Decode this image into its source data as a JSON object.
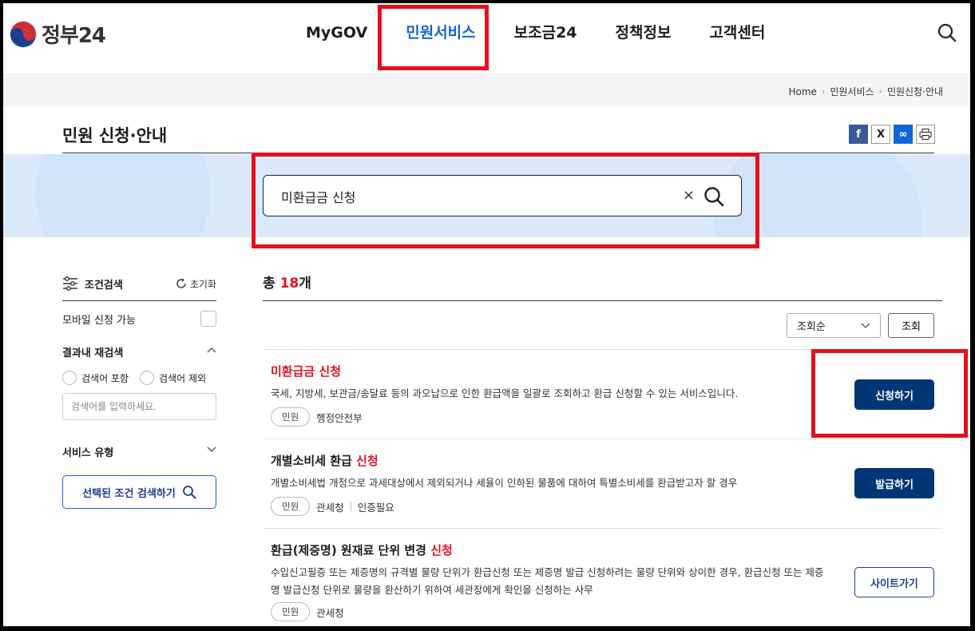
{
  "header": {
    "logo_text": "정부24",
    "nav": [
      "MyGOV",
      "민원서비스",
      "보조금24",
      "정책정보",
      "고객센터"
    ],
    "active_nav": "민원서비스"
  },
  "breadcrumb": [
    "Home",
    "민원서비스",
    "민원신청·안내"
  ],
  "page_title": "민원 신청·안내",
  "share_icons": [
    "facebook-icon",
    "x-icon",
    "link-icon",
    "print-icon"
  ],
  "search": {
    "value": "미환급금 신청",
    "clear_label": "×"
  },
  "sidebar": {
    "title": "조건검색",
    "reset_label": "초기화",
    "mobile_label": "모바일 신청 가능",
    "research_label": "결과내 재검색",
    "include_label": "검색어 포함",
    "exclude_label": "검색어 제외",
    "input_placeholder": "검색어를 입력하세요.",
    "service_type_label": "서비스 유형",
    "submit_label": "선택된 조건 검색하기"
  },
  "results": {
    "total_prefix": "총 ",
    "total_count": "18",
    "total_suffix": "개",
    "sort_value": "조회순",
    "sort_button": "조회",
    "items": [
      {
        "title_plain": "",
        "title_highlight": "미환급금 신청",
        "desc": "국세, 지방세, 보관금/송달료 등의 과오납으로 인한 환급액을 일괄로 조회하고 환급 신청할 수 있는 서비스입니다.",
        "type": "민원",
        "org": "행정안전부",
        "extra": "",
        "action": "신청하기"
      },
      {
        "title_plain": "개별소비세 환급 ",
        "title_highlight": "신청",
        "desc": "개별소비세법 개정으로 과세대상에서 제외되거나 세율이 인하된 물품에 대하여 특별소비세를 환급받고자 할 경우",
        "type": "민원",
        "org": "관세청",
        "extra": "인증필요",
        "action": "발급하기"
      },
      {
        "title_plain": "환급(제증명) 원재료 단위 변경 ",
        "title_highlight": "신청",
        "desc": "수입신고필증 또는 제증명의 규격별 물량 단위가 환급신청 또는 제증명 발급 신청하려는 물량 단위와 상이한 경우, 환급신청 또는 제증명 발급신청 단위로 물량을 환산하기 위하여 세관장에게 확인을 신청하는 사무",
        "type": "민원",
        "org": "관세청",
        "extra": "",
        "action": "사이트가기"
      }
    ]
  },
  "colors": {
    "accent_red": "#e3101e",
    "primary_navy": "#003676",
    "nav_active": "#1364d6",
    "band": "#dbeafb"
  }
}
